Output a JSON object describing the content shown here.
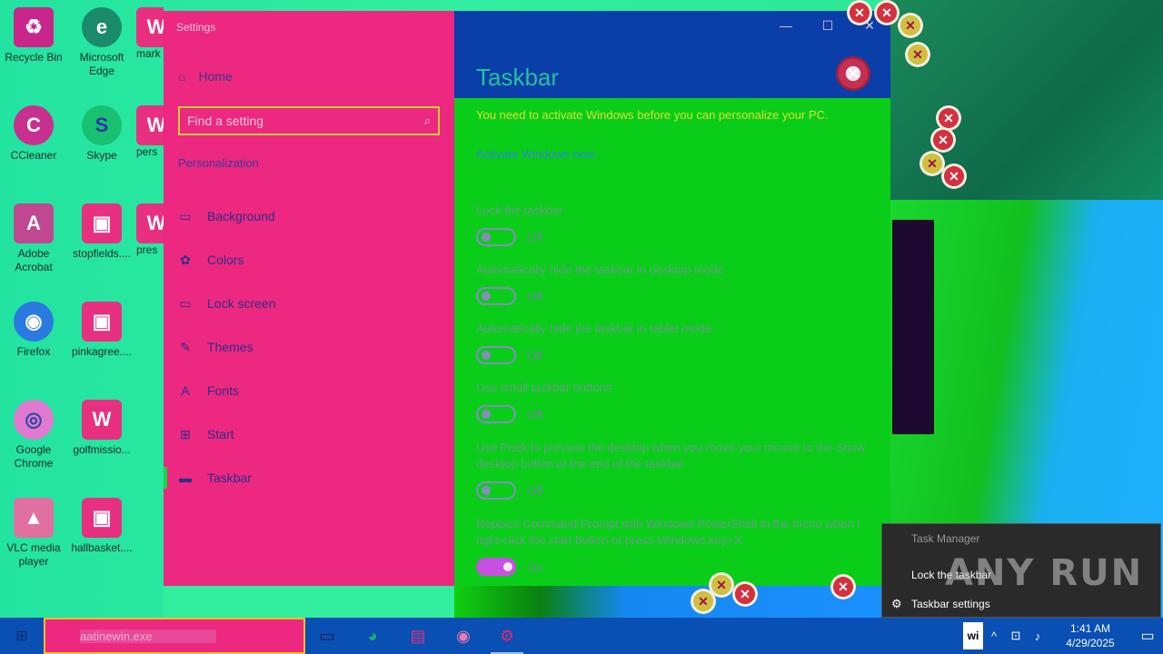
{
  "desktop": {
    "icons": [
      {
        "label": "Recycle Bin",
        "glyph": "♻",
        "color": "#c8268a"
      },
      {
        "label": "Microsoft Edge",
        "glyph": "e",
        "color": "#1a8a6a"
      },
      {
        "label": "mark",
        "glyph": "W",
        "color": "#e83080"
      },
      {
        "label": "CCleaner",
        "glyph": "C",
        "color": "#c83090"
      },
      {
        "label": "Skype",
        "glyph": "S",
        "color": "#18c070"
      },
      {
        "label": "pers",
        "glyph": "W",
        "color": "#e83080"
      },
      {
        "label": "Adobe Acrobat",
        "glyph": "A",
        "color": "#c04890"
      },
      {
        "label": "stopfields....",
        "glyph": "▣",
        "color": "#e83080"
      },
      {
        "label": "pres",
        "glyph": "W",
        "color": "#e83080"
      },
      {
        "label": "Firefox",
        "glyph": "◉",
        "color": "#2a7ae0"
      },
      {
        "label": "pinkagree....",
        "glyph": "▣",
        "color": "#e83080"
      },
      {
        "label": "Google Chrome",
        "glyph": "◎",
        "color": "#e07ad0"
      },
      {
        "label": "golfmissio...",
        "glyph": "W",
        "color": "#e83080"
      },
      {
        "label": "VLC media player",
        "glyph": "▲",
        "color": "#e070a0"
      },
      {
        "label": "hallbasket....",
        "glyph": "▣",
        "color": "#e83080"
      }
    ]
  },
  "settings": {
    "app_title": "Settings",
    "home_label": "Home",
    "search_placeholder": "Find a setting",
    "section_label": "Personalization",
    "nav_items": [
      {
        "label": "Background",
        "icon": "picture-icon"
      },
      {
        "label": "Colors",
        "icon": "palette-icon"
      },
      {
        "label": "Lock screen",
        "icon": "monitor-icon"
      },
      {
        "label": "Themes",
        "icon": "brush-icon"
      },
      {
        "label": "Fonts",
        "icon": "font-icon"
      },
      {
        "label": "Start",
        "icon": "start-icon"
      },
      {
        "label": "Taskbar",
        "icon": "taskbar-icon",
        "active": true
      }
    ],
    "page_title": "Taskbar",
    "warning": "You need to activate Windows before you can personalize your PC.",
    "activate_link": "Activate Windows now.",
    "options": [
      {
        "label": "Lock the taskbar",
        "state": "Off",
        "on": false
      },
      {
        "label": "Automatically hide the taskbar in desktop mode",
        "state": "Off",
        "on": false
      },
      {
        "label": "Automatically hide the taskbar in tablet mode",
        "state": "Off",
        "on": false
      },
      {
        "label": "Use small taskbar buttons",
        "state": "Off",
        "on": false
      },
      {
        "label": "Use Peek to preview the desktop when you move your mouse to the Show desktop button at the end of the taskbar",
        "state": "Off",
        "on": false
      },
      {
        "label": "Replace Command Prompt with Windows PowerShell in the menu when I right-click the start button or press Windows key+X",
        "state": "On",
        "on": true
      }
    ],
    "window_controls": {
      "minimize": "—",
      "maximize": "☐",
      "close": "✕"
    }
  },
  "context_menu": {
    "items": [
      {
        "label": "Task Manager",
        "disabled": true
      },
      {
        "label": "Lock the taskbar",
        "disabled": false
      },
      {
        "label": "Taskbar settings",
        "disabled": false,
        "icon": "gear-icon"
      }
    ]
  },
  "watermark": "ANY RUN",
  "taskbar": {
    "search_value": "aatinewin.exe",
    "tray_app": "wi",
    "clock_time": "1:41 AM",
    "clock_date": "4/29/2025"
  }
}
